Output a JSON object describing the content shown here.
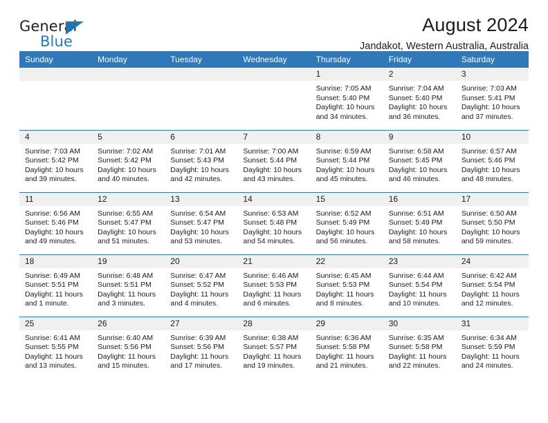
{
  "brand": {
    "name_top": "General",
    "name_bottom": "Blue",
    "triangle_color": "#1f74b8",
    "text_color_top": "#231f20",
    "text_color_bottom": "#2179c0"
  },
  "header": {
    "title": "August 2024",
    "subtitle": "Jandakot, Western Australia, Australia"
  },
  "theme": {
    "header_blue": "#2f79b8",
    "daynum_band": "#f0f0f0",
    "row_divider": "#2f79b8",
    "text": "#1a1a1a"
  },
  "calendar": {
    "weekday_headers": [
      "Sunday",
      "Monday",
      "Tuesday",
      "Wednesday",
      "Thursday",
      "Friday",
      "Saturday"
    ],
    "labels": {
      "sunrise": "Sunrise:",
      "sunset": "Sunset:",
      "daylight": "Daylight:"
    },
    "weeks": [
      [
        {
          "day": ""
        },
        {
          "day": ""
        },
        {
          "day": ""
        },
        {
          "day": ""
        },
        {
          "day": "1",
          "sunrise": "Sunrise: 7:05 AM",
          "sunset": "Sunset: 5:40 PM",
          "daylight": "Daylight: 10 hours and 34 minutes."
        },
        {
          "day": "2",
          "sunrise": "Sunrise: 7:04 AM",
          "sunset": "Sunset: 5:40 PM",
          "daylight": "Daylight: 10 hours and 36 minutes."
        },
        {
          "day": "3",
          "sunrise": "Sunrise: 7:03 AM",
          "sunset": "Sunset: 5:41 PM",
          "daylight": "Daylight: 10 hours and 37 minutes."
        }
      ],
      [
        {
          "day": "4",
          "sunrise": "Sunrise: 7:03 AM",
          "sunset": "Sunset: 5:42 PM",
          "daylight": "Daylight: 10 hours and 39 minutes."
        },
        {
          "day": "5",
          "sunrise": "Sunrise: 7:02 AM",
          "sunset": "Sunset: 5:42 PM",
          "daylight": "Daylight: 10 hours and 40 minutes."
        },
        {
          "day": "6",
          "sunrise": "Sunrise: 7:01 AM",
          "sunset": "Sunset: 5:43 PM",
          "daylight": "Daylight: 10 hours and 42 minutes."
        },
        {
          "day": "7",
          "sunrise": "Sunrise: 7:00 AM",
          "sunset": "Sunset: 5:44 PM",
          "daylight": "Daylight: 10 hours and 43 minutes."
        },
        {
          "day": "8",
          "sunrise": "Sunrise: 6:59 AM",
          "sunset": "Sunset: 5:44 PM",
          "daylight": "Daylight: 10 hours and 45 minutes."
        },
        {
          "day": "9",
          "sunrise": "Sunrise: 6:58 AM",
          "sunset": "Sunset: 5:45 PM",
          "daylight": "Daylight: 10 hours and 46 minutes."
        },
        {
          "day": "10",
          "sunrise": "Sunrise: 6:57 AM",
          "sunset": "Sunset: 5:46 PM",
          "daylight": "Daylight: 10 hours and 48 minutes."
        }
      ],
      [
        {
          "day": "11",
          "sunrise": "Sunrise: 6:56 AM",
          "sunset": "Sunset: 5:46 PM",
          "daylight": "Daylight: 10 hours and 49 minutes."
        },
        {
          "day": "12",
          "sunrise": "Sunrise: 6:55 AM",
          "sunset": "Sunset: 5:47 PM",
          "daylight": "Daylight: 10 hours and 51 minutes."
        },
        {
          "day": "13",
          "sunrise": "Sunrise: 6:54 AM",
          "sunset": "Sunset: 5:47 PM",
          "daylight": "Daylight: 10 hours and 53 minutes."
        },
        {
          "day": "14",
          "sunrise": "Sunrise: 6:53 AM",
          "sunset": "Sunset: 5:48 PM",
          "daylight": "Daylight: 10 hours and 54 minutes."
        },
        {
          "day": "15",
          "sunrise": "Sunrise: 6:52 AM",
          "sunset": "Sunset: 5:49 PM",
          "daylight": "Daylight: 10 hours and 56 minutes."
        },
        {
          "day": "16",
          "sunrise": "Sunrise: 6:51 AM",
          "sunset": "Sunset: 5:49 PM",
          "daylight": "Daylight: 10 hours and 58 minutes."
        },
        {
          "day": "17",
          "sunrise": "Sunrise: 6:50 AM",
          "sunset": "Sunset: 5:50 PM",
          "daylight": "Daylight: 10 hours and 59 minutes."
        }
      ],
      [
        {
          "day": "18",
          "sunrise": "Sunrise: 6:49 AM",
          "sunset": "Sunset: 5:51 PM",
          "daylight": "Daylight: 11 hours and 1 minute."
        },
        {
          "day": "19",
          "sunrise": "Sunrise: 6:48 AM",
          "sunset": "Sunset: 5:51 PM",
          "daylight": "Daylight: 11 hours and 3 minutes."
        },
        {
          "day": "20",
          "sunrise": "Sunrise: 6:47 AM",
          "sunset": "Sunset: 5:52 PM",
          "daylight": "Daylight: 11 hours and 4 minutes."
        },
        {
          "day": "21",
          "sunrise": "Sunrise: 6:46 AM",
          "sunset": "Sunset: 5:53 PM",
          "daylight": "Daylight: 11 hours and 6 minutes."
        },
        {
          "day": "22",
          "sunrise": "Sunrise: 6:45 AM",
          "sunset": "Sunset: 5:53 PM",
          "daylight": "Daylight: 11 hours and 8 minutes."
        },
        {
          "day": "23",
          "sunrise": "Sunrise: 6:44 AM",
          "sunset": "Sunset: 5:54 PM",
          "daylight": "Daylight: 11 hours and 10 minutes."
        },
        {
          "day": "24",
          "sunrise": "Sunrise: 6:42 AM",
          "sunset": "Sunset: 5:54 PM",
          "daylight": "Daylight: 11 hours and 12 minutes."
        }
      ],
      [
        {
          "day": "25",
          "sunrise": "Sunrise: 6:41 AM",
          "sunset": "Sunset: 5:55 PM",
          "daylight": "Daylight: 11 hours and 13 minutes."
        },
        {
          "day": "26",
          "sunrise": "Sunrise: 6:40 AM",
          "sunset": "Sunset: 5:56 PM",
          "daylight": "Daylight: 11 hours and 15 minutes."
        },
        {
          "day": "27",
          "sunrise": "Sunrise: 6:39 AM",
          "sunset": "Sunset: 5:56 PM",
          "daylight": "Daylight: 11 hours and 17 minutes."
        },
        {
          "day": "28",
          "sunrise": "Sunrise: 6:38 AM",
          "sunset": "Sunset: 5:57 PM",
          "daylight": "Daylight: 11 hours and 19 minutes."
        },
        {
          "day": "29",
          "sunrise": "Sunrise: 6:36 AM",
          "sunset": "Sunset: 5:58 PM",
          "daylight": "Daylight: 11 hours and 21 minutes."
        },
        {
          "day": "30",
          "sunrise": "Sunrise: 6:35 AM",
          "sunset": "Sunset: 5:58 PM",
          "daylight": "Daylight: 11 hours and 22 minutes."
        },
        {
          "day": "31",
          "sunrise": "Sunrise: 6:34 AM",
          "sunset": "Sunset: 5:59 PM",
          "daylight": "Daylight: 11 hours and 24 minutes."
        }
      ]
    ]
  }
}
